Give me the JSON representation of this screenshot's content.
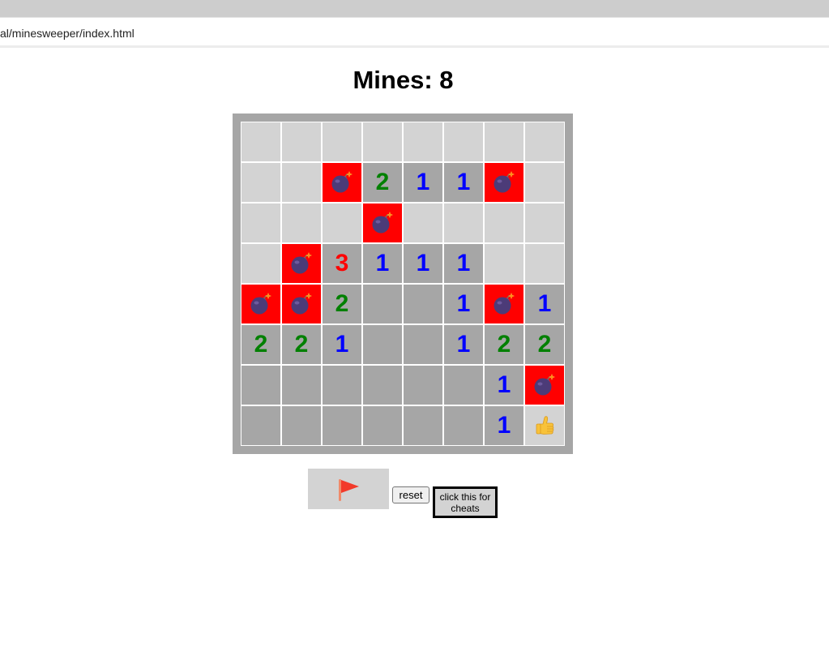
{
  "browser": {
    "address": "al/minesweeper/index.html"
  },
  "game": {
    "title": "Mines: 8",
    "rows": [
      [
        {
          "s": "hidden"
        },
        {
          "s": "hidden"
        },
        {
          "s": "hidden"
        },
        {
          "s": "hidden"
        },
        {
          "s": "hidden"
        },
        {
          "s": "hidden"
        },
        {
          "s": "hidden"
        },
        {
          "s": "hidden"
        }
      ],
      [
        {
          "s": "hidden"
        },
        {
          "s": "hidden"
        },
        {
          "s": "mine"
        },
        {
          "s": "open",
          "n": "2"
        },
        {
          "s": "open",
          "n": "1"
        },
        {
          "s": "open",
          "n": "1"
        },
        {
          "s": "mine"
        },
        {
          "s": "hidden"
        }
      ],
      [
        {
          "s": "hidden"
        },
        {
          "s": "hidden"
        },
        {
          "s": "hidden"
        },
        {
          "s": "mine"
        },
        {
          "s": "hidden"
        },
        {
          "s": "hidden"
        },
        {
          "s": "hidden"
        },
        {
          "s": "hidden"
        }
      ],
      [
        {
          "s": "hidden"
        },
        {
          "s": "mine"
        },
        {
          "s": "open",
          "n": "3"
        },
        {
          "s": "open",
          "n": "1"
        },
        {
          "s": "open",
          "n": "1"
        },
        {
          "s": "open",
          "n": "1"
        },
        {
          "s": "hidden"
        },
        {
          "s": "hidden"
        }
      ],
      [
        {
          "s": "mine"
        },
        {
          "s": "mine"
        },
        {
          "s": "open",
          "n": "2"
        },
        {
          "s": "open"
        },
        {
          "s": "open"
        },
        {
          "s": "open",
          "n": "1"
        },
        {
          "s": "mine"
        },
        {
          "s": "open",
          "n": "1"
        }
      ],
      [
        {
          "s": "open",
          "n": "2"
        },
        {
          "s": "open",
          "n": "2"
        },
        {
          "s": "open",
          "n": "1"
        },
        {
          "s": "open"
        },
        {
          "s": "open"
        },
        {
          "s": "open",
          "n": "1"
        },
        {
          "s": "open",
          "n": "2"
        },
        {
          "s": "open",
          "n": "2"
        }
      ],
      [
        {
          "s": "open"
        },
        {
          "s": "open"
        },
        {
          "s": "open"
        },
        {
          "s": "open"
        },
        {
          "s": "open"
        },
        {
          "s": "open"
        },
        {
          "s": "open",
          "n": "1"
        },
        {
          "s": "mine"
        }
      ],
      [
        {
          "s": "open"
        },
        {
          "s": "open"
        },
        {
          "s": "open"
        },
        {
          "s": "open"
        },
        {
          "s": "open"
        },
        {
          "s": "open"
        },
        {
          "s": "open",
          "n": "1"
        },
        {
          "s": "thumb"
        }
      ]
    ],
    "colors": {
      "hidden": "#d3d3d3",
      "open": "#a6a6a6",
      "mine": "#ff0000",
      "n1": "#0000ff",
      "n2": "#008000",
      "n3": "#ff0000"
    },
    "icons": {
      "mine": "bomb-icon",
      "thumb": "thumbs-up-icon",
      "flag": "flag-icon"
    }
  },
  "controls": {
    "reset_label": "reset",
    "cheats_label": "click this for cheats"
  }
}
